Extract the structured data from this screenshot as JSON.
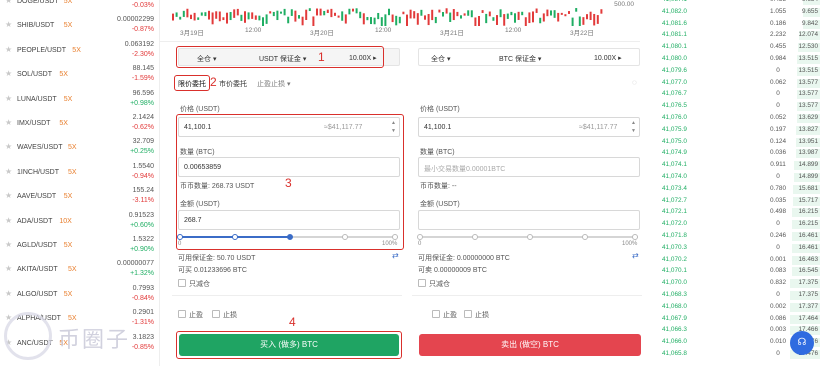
{
  "colors": {
    "buy": "#1fa463",
    "sell": "#e4454f",
    "accent": "#e87d2b",
    "highlight": "#d9302c",
    "up": "#1fae63",
    "down": "#e23a3a"
  },
  "watchlist": [
    {
      "symbol": "DOGE/USDT",
      "lev": "5X",
      "price": "0.119559",
      "chg": "-0.03%",
      "dir": "down"
    },
    {
      "symbol": "SHIB/USDT",
      "lev": "5X",
      "price": "0.00002299",
      "chg": "-0.87%",
      "dir": "down"
    },
    {
      "symbol": "PEOPLE/USDT",
      "lev": "5X",
      "price": "0.063192",
      "chg": "-2.30%",
      "dir": "down"
    },
    {
      "symbol": "SOL/USDT",
      "lev": "5X",
      "price": "88.145",
      "chg": "-1.59%",
      "dir": "down"
    },
    {
      "symbol": "LUNA/USDT",
      "lev": "5X",
      "price": "96.596",
      "chg": "+0.98%",
      "dir": "up"
    },
    {
      "symbol": "IMX/USDT",
      "lev": "5X",
      "price": "2.1424",
      "chg": "-0.62%",
      "dir": "down"
    },
    {
      "symbol": "WAVES/USDT",
      "lev": "5X",
      "price": "32.709",
      "chg": "+0.25%",
      "dir": "up"
    },
    {
      "symbol": "1INCH/USDT",
      "lev": "5X",
      "price": "1.5540",
      "chg": "-0.94%",
      "dir": "down"
    },
    {
      "symbol": "AAVE/USDT",
      "lev": "5X",
      "price": "155.24",
      "chg": "-3.11%",
      "dir": "down"
    },
    {
      "symbol": "ADA/USDT",
      "lev": "10X",
      "price": "0.91523",
      "chg": "+0.60%",
      "dir": "up"
    },
    {
      "symbol": "AGLD/USDT",
      "lev": "5X",
      "price": "1.5322",
      "chg": "+0.90%",
      "dir": "up"
    },
    {
      "symbol": "AKITA/USDT",
      "lev": "5X",
      "price": "0.00000077",
      "chg": "+1.32%",
      "dir": "up"
    },
    {
      "symbol": "ALGO/USDT",
      "lev": "5X",
      "price": "0.7993",
      "chg": "-0.84%",
      "dir": "down"
    },
    {
      "symbol": "ALPHA/USDT",
      "lev": "5X",
      "price": "0.2901",
      "chg": "-1.31%",
      "dir": "down"
    },
    {
      "symbol": "ANC/USDT",
      "lev": "5X",
      "price": "3.1823",
      "chg": "-0.85%",
      "dir": "down"
    }
  ],
  "chart": {
    "dates": [
      "3月19日",
      "12:00",
      "3月20日",
      "12:00",
      "3月21日",
      "12:00",
      "3月22日"
    ],
    "price_label": "500.00"
  },
  "order_form": {
    "margin_mode": "全仓",
    "margin_type": "USDT 保证金",
    "leverage": "10.00X",
    "tabs": [
      "限价委托",
      "市价委托",
      "止盈止损"
    ],
    "price_label": "价格 (USDT)",
    "price_value": "41,100.1",
    "price_equiv": "≈$41,117.77",
    "qty_label": "数量 (BTC)",
    "qty_value": "0.00653859",
    "coin_qty_label": "币币数量: 268.73 USDT",
    "amount_label": "金额 (USDT)",
    "amount_value": "268.7",
    "slider_min": "0",
    "slider_max": "100%",
    "avail_margin": "可用保证金: 50.70 USDT",
    "can_buy": "可买 0.01233696 BTC",
    "reduce_only": "只减仓",
    "tp": "止盈",
    "sl": "止损",
    "buy_button": "买入 (做多) BTC"
  },
  "sell_form": {
    "margin_mode": "全仓",
    "margin_type": "BTC 保证金",
    "leverage": "10.00X",
    "price_label": "价格 (USDT)",
    "price_value": "41,100.1",
    "price_equiv": "≈$41,117.77",
    "qty_label": "数量 (BTC)",
    "qty_placeholder": "最小交易数量0.00001BTC",
    "coin_qty_label": "币币数量: --",
    "amount_label": "金额 (USDT)",
    "slider_min": "0",
    "slider_max": "100%",
    "avail_margin": "可用保证金: 0.00000000 BTC",
    "can_sell": "可卖 0.00000009 BTC",
    "reduce_only": "只减仓",
    "tp": "止盈",
    "sl": "止损",
    "sell_button": "卖出 (做空) BTC"
  },
  "annotations": [
    "1",
    "2",
    "3",
    "4"
  ],
  "watermark": "币圈子",
  "orderbook": [
    [
      "41,087.1",
      "0.455",
      "9.654"
    ],
    [
      "41,082.0",
      "1.055",
      "9.655"
    ],
    [
      "41,081.6",
      "0.186",
      "9.842"
    ],
    [
      "41,081.1",
      "2.232",
      "12.074"
    ],
    [
      "41,080.1",
      "0.455",
      "12.530"
    ],
    [
      "41,080.0",
      "0.984",
      "13.515"
    ],
    [
      "41,079.6",
      "0",
      "13.515"
    ],
    [
      "41,077.0",
      "0.062",
      "13.577"
    ],
    [
      "41,076.7",
      "0",
      "13.577"
    ],
    [
      "41,076.5",
      "0",
      "13.577"
    ],
    [
      "41,076.0",
      "0.052",
      "13.629"
    ],
    [
      "41,075.9",
      "0.197",
      "13.827"
    ],
    [
      "41,075.0",
      "0.124",
      "13.951"
    ],
    [
      "41,074.9",
      "0.036",
      "13.987"
    ],
    [
      "41,074.1",
      "0.911",
      "14.899"
    ],
    [
      "41,074.0",
      "0",
      "14.899"
    ],
    [
      "41,073.4",
      "0.780",
      "15.681"
    ],
    [
      "41,072.7",
      "0.035",
      "15.717"
    ],
    [
      "41,072.1",
      "0.498",
      "16.215"
    ],
    [
      "41,072.0",
      "0",
      "16.215"
    ],
    [
      "41,071.8",
      "0.246",
      "16.461"
    ],
    [
      "41,070.3",
      "0",
      "16.461"
    ],
    [
      "41,070.2",
      "0.001",
      "16.463"
    ],
    [
      "41,070.1",
      "0.083",
      "16.545"
    ],
    [
      "41,070.0",
      "0.832",
      "17.375"
    ],
    [
      "41,068.3",
      "0",
      "17.375"
    ],
    [
      "41,068.0",
      "0.002",
      "17.377"
    ],
    [
      "41,067.9",
      "0.086",
      "17.464"
    ],
    [
      "41,066.3",
      "0.003",
      "17.466"
    ],
    [
      "41,066.0",
      "0.010",
      "17.476"
    ],
    [
      "41,065.8",
      "0",
      "17.476"
    ]
  ]
}
